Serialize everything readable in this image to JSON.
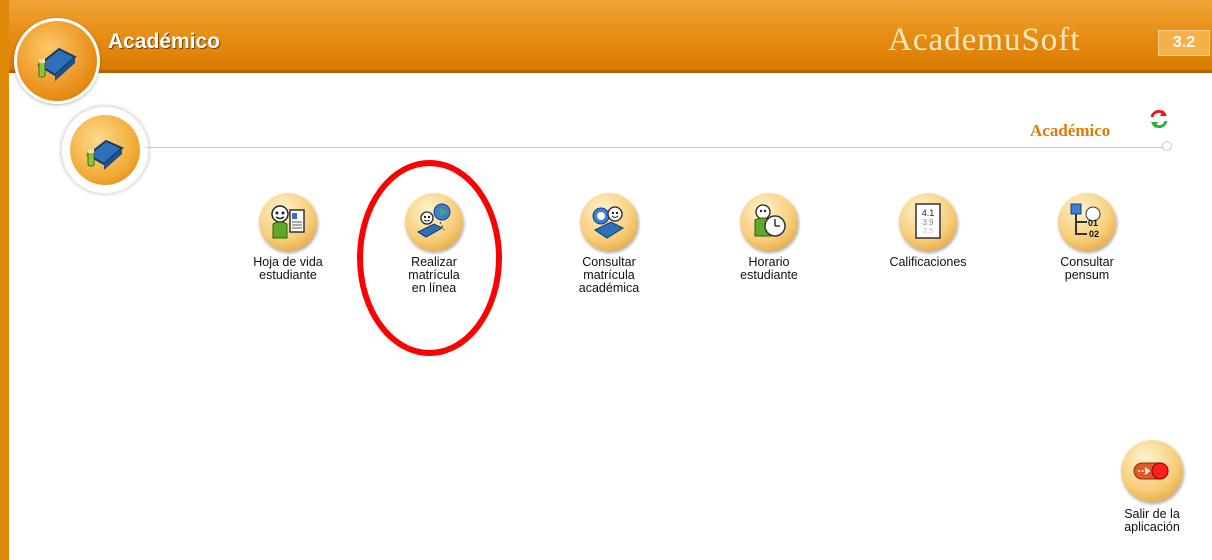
{
  "header": {
    "title": "Académico",
    "brand": "AcademuSoft",
    "version": "3.2"
  },
  "section": {
    "title": "Académico"
  },
  "modules": [
    {
      "label": "Hoja de vida\nestudiante",
      "icon": "student-resume-icon"
    },
    {
      "label": "Realizar\nmatrícula\nen línea",
      "icon": "online-enrollment-icon"
    },
    {
      "label": "Consultar\nmatrícula\nacadémica",
      "icon": "enrollment-query-icon"
    },
    {
      "label": "Horario\nestudiante",
      "icon": "student-schedule-icon"
    },
    {
      "label": "Calificaciones",
      "icon": "grades-icon"
    },
    {
      "label": "Consultar\npensum",
      "icon": "curriculum-query-icon"
    }
  ],
  "exit": {
    "label": "Salir de la\naplicación",
    "icon": "exit-toggle-icon"
  },
  "colors": {
    "header": "#e88f16",
    "accent_text": "#e07a06",
    "highlight": "#ff0000"
  }
}
